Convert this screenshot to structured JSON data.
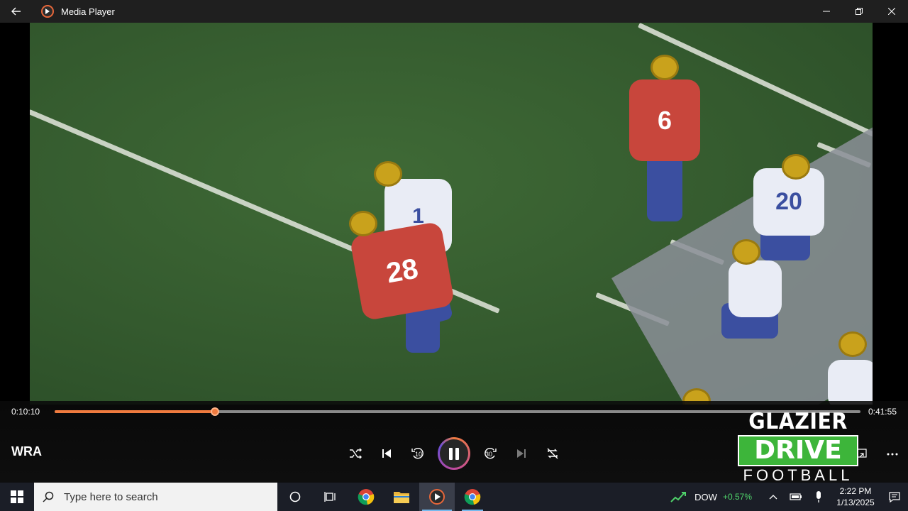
{
  "window": {
    "title": "Media Player"
  },
  "video": {
    "jersey_numbers": [
      "28",
      "6",
      "1",
      "20",
      "20"
    ]
  },
  "playback": {
    "current_time": "0:10:10",
    "total_time": "0:41:55",
    "progress_fraction": 0.199,
    "media_title": "WRA",
    "skip_back_seconds": "10",
    "skip_forward_seconds": "30",
    "state": "playing"
  },
  "watermark": {
    "line1": "GLAZIER",
    "line2": "DRIVE",
    "line3": "FOOTBALL"
  },
  "taskbar": {
    "search_placeholder": "Type here to search",
    "stock_name": "DOW",
    "stock_change": "+0.57%",
    "time": "2:22 PM",
    "date": "1/13/2025"
  },
  "colors": {
    "accent": "#f07b3f",
    "field": "#345a2e",
    "stock_positive": "#4fd16a"
  }
}
